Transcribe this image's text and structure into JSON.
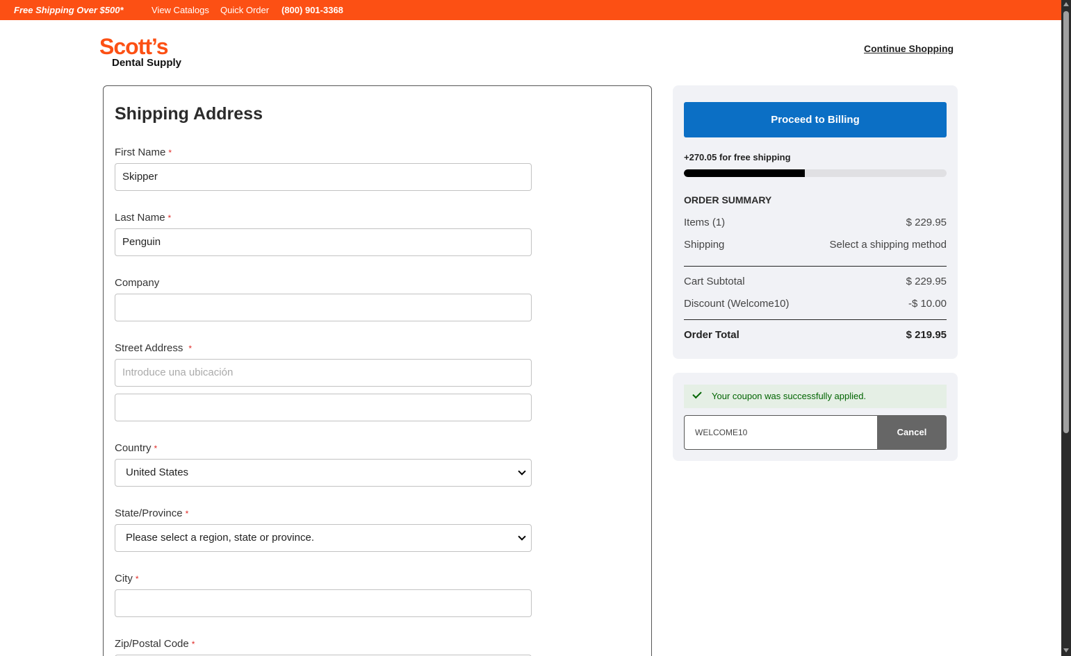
{
  "topbar": {
    "promo": "Free Shipping Over $500*",
    "view_catalogs": "View Catalogs",
    "quick_order": "Quick Order",
    "phone": "(800) 901-3368"
  },
  "logo": {
    "main": "Scott’s",
    "sub": "Dental Supply"
  },
  "header": {
    "continue_shopping": "Continue Shopping"
  },
  "form": {
    "title": "Shipping Address",
    "required_mark": "*",
    "first_name": {
      "label": "First Name",
      "value": "Skipper"
    },
    "last_name": {
      "label": "Last Name",
      "value": "Penguin"
    },
    "company": {
      "label": "Company",
      "value": ""
    },
    "street": {
      "label": "Street Address",
      "placeholder": "Introduce una ubicación",
      "line2": ""
    },
    "country": {
      "label": "Country",
      "value": "United States"
    },
    "state": {
      "label": "State/Province",
      "value": "Please select a region, state or province."
    },
    "city": {
      "label": "City",
      "value": ""
    },
    "zip": {
      "label": "Zip/Postal Code"
    }
  },
  "summary": {
    "proceed_button": "Proceed to Billing",
    "free_shipping_note": "+270.05 for free shipping",
    "free_shipping_progress": 0.46,
    "title": "ORDER SUMMARY",
    "items_label": "Items (1)",
    "items_value": "$ 229.95",
    "shipping_label": "Shipping",
    "shipping_value": "Select a shipping method",
    "subtotal_label": "Cart Subtotal",
    "subtotal_value": "$ 229.95",
    "discount_label": "Discount (Welcome10)",
    "discount_value": "-$ 10.00",
    "total_label": "Order Total",
    "total_value": "$ 219.95"
  },
  "coupon": {
    "message": "Your coupon was successfully applied.",
    "code": "WELCOME10",
    "cancel_button": "Cancel"
  },
  "colors": {
    "brand_orange": "#fc5014",
    "primary_blue": "#0b6fc5",
    "success_green": "#006400"
  }
}
